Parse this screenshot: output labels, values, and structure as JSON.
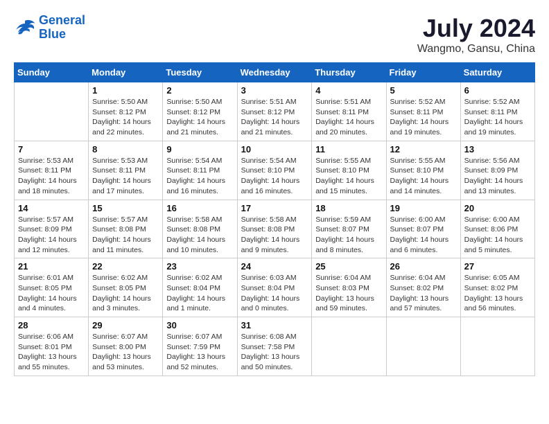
{
  "header": {
    "logo_line1": "General",
    "logo_line2": "Blue",
    "title": "July 2024",
    "subtitle": "Wangmo, Gansu, China"
  },
  "weekdays": [
    "Sunday",
    "Monday",
    "Tuesday",
    "Wednesday",
    "Thursday",
    "Friday",
    "Saturday"
  ],
  "weeks": [
    [
      {
        "day": "",
        "info": ""
      },
      {
        "day": "1",
        "info": "Sunrise: 5:50 AM\nSunset: 8:12 PM\nDaylight: 14 hours\nand 22 minutes."
      },
      {
        "day": "2",
        "info": "Sunrise: 5:50 AM\nSunset: 8:12 PM\nDaylight: 14 hours\nand 21 minutes."
      },
      {
        "day": "3",
        "info": "Sunrise: 5:51 AM\nSunset: 8:12 PM\nDaylight: 14 hours\nand 21 minutes."
      },
      {
        "day": "4",
        "info": "Sunrise: 5:51 AM\nSunset: 8:11 PM\nDaylight: 14 hours\nand 20 minutes."
      },
      {
        "day": "5",
        "info": "Sunrise: 5:52 AM\nSunset: 8:11 PM\nDaylight: 14 hours\nand 19 minutes."
      },
      {
        "day": "6",
        "info": "Sunrise: 5:52 AM\nSunset: 8:11 PM\nDaylight: 14 hours\nand 19 minutes."
      }
    ],
    [
      {
        "day": "7",
        "info": "Sunrise: 5:53 AM\nSunset: 8:11 PM\nDaylight: 14 hours\nand 18 minutes."
      },
      {
        "day": "8",
        "info": "Sunrise: 5:53 AM\nSunset: 8:11 PM\nDaylight: 14 hours\nand 17 minutes."
      },
      {
        "day": "9",
        "info": "Sunrise: 5:54 AM\nSunset: 8:11 PM\nDaylight: 14 hours\nand 16 minutes."
      },
      {
        "day": "10",
        "info": "Sunrise: 5:54 AM\nSunset: 8:10 PM\nDaylight: 14 hours\nand 16 minutes."
      },
      {
        "day": "11",
        "info": "Sunrise: 5:55 AM\nSunset: 8:10 PM\nDaylight: 14 hours\nand 15 minutes."
      },
      {
        "day": "12",
        "info": "Sunrise: 5:55 AM\nSunset: 8:10 PM\nDaylight: 14 hours\nand 14 minutes."
      },
      {
        "day": "13",
        "info": "Sunrise: 5:56 AM\nSunset: 8:09 PM\nDaylight: 14 hours\nand 13 minutes."
      }
    ],
    [
      {
        "day": "14",
        "info": "Sunrise: 5:57 AM\nSunset: 8:09 PM\nDaylight: 14 hours\nand 12 minutes."
      },
      {
        "day": "15",
        "info": "Sunrise: 5:57 AM\nSunset: 8:08 PM\nDaylight: 14 hours\nand 11 minutes."
      },
      {
        "day": "16",
        "info": "Sunrise: 5:58 AM\nSunset: 8:08 PM\nDaylight: 14 hours\nand 10 minutes."
      },
      {
        "day": "17",
        "info": "Sunrise: 5:58 AM\nSunset: 8:08 PM\nDaylight: 14 hours\nand 9 minutes."
      },
      {
        "day": "18",
        "info": "Sunrise: 5:59 AM\nSunset: 8:07 PM\nDaylight: 14 hours\nand 8 minutes."
      },
      {
        "day": "19",
        "info": "Sunrise: 6:00 AM\nSunset: 8:07 PM\nDaylight: 14 hours\nand 6 minutes."
      },
      {
        "day": "20",
        "info": "Sunrise: 6:00 AM\nSunset: 8:06 PM\nDaylight: 14 hours\nand 5 minutes."
      }
    ],
    [
      {
        "day": "21",
        "info": "Sunrise: 6:01 AM\nSunset: 8:05 PM\nDaylight: 14 hours\nand 4 minutes."
      },
      {
        "day": "22",
        "info": "Sunrise: 6:02 AM\nSunset: 8:05 PM\nDaylight: 14 hours\nand 3 minutes."
      },
      {
        "day": "23",
        "info": "Sunrise: 6:02 AM\nSunset: 8:04 PM\nDaylight: 14 hours\nand 1 minute."
      },
      {
        "day": "24",
        "info": "Sunrise: 6:03 AM\nSunset: 8:04 PM\nDaylight: 14 hours\nand 0 minutes."
      },
      {
        "day": "25",
        "info": "Sunrise: 6:04 AM\nSunset: 8:03 PM\nDaylight: 13 hours\nand 59 minutes."
      },
      {
        "day": "26",
        "info": "Sunrise: 6:04 AM\nSunset: 8:02 PM\nDaylight: 13 hours\nand 57 minutes."
      },
      {
        "day": "27",
        "info": "Sunrise: 6:05 AM\nSunset: 8:02 PM\nDaylight: 13 hours\nand 56 minutes."
      }
    ],
    [
      {
        "day": "28",
        "info": "Sunrise: 6:06 AM\nSunset: 8:01 PM\nDaylight: 13 hours\nand 55 minutes."
      },
      {
        "day": "29",
        "info": "Sunrise: 6:07 AM\nSunset: 8:00 PM\nDaylight: 13 hours\nand 53 minutes."
      },
      {
        "day": "30",
        "info": "Sunrise: 6:07 AM\nSunset: 7:59 PM\nDaylight: 13 hours\nand 52 minutes."
      },
      {
        "day": "31",
        "info": "Sunrise: 6:08 AM\nSunset: 7:58 PM\nDaylight: 13 hours\nand 50 minutes."
      },
      {
        "day": "",
        "info": ""
      },
      {
        "day": "",
        "info": ""
      },
      {
        "day": "",
        "info": ""
      }
    ]
  ]
}
